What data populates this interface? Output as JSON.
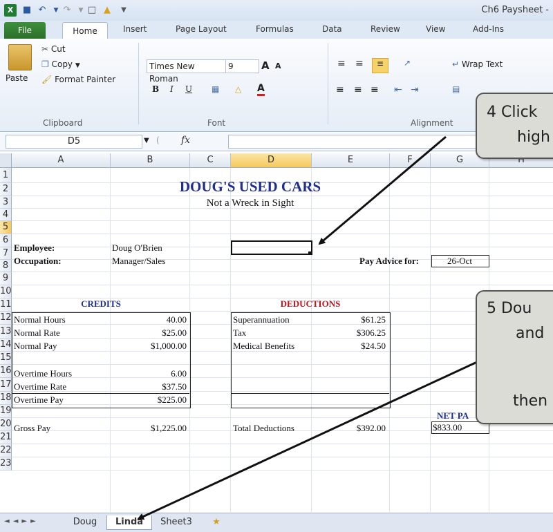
{
  "window": {
    "title": "Ch6 Paysheet -"
  },
  "quick_access": [
    "save-icon",
    "undo-icon",
    "redo-icon",
    "new-icon",
    "open-icon"
  ],
  "ribbon_tabs": [
    "File",
    "Home",
    "Insert",
    "Page Layout",
    "Formulas",
    "Data",
    "Review",
    "View",
    "Add-Ins"
  ],
  "clipboard": {
    "paste": "Paste",
    "cut": "Cut",
    "copy": "Copy",
    "format_painter": "Format Painter",
    "label": "Clipboard"
  },
  "font": {
    "name": "Times New Roman",
    "size": "9",
    "label": "Font",
    "bold": "B",
    "italic": "I",
    "underline": "U",
    "grow": "A",
    "shrink": "A"
  },
  "alignment": {
    "wrap_text": "Wrap Text",
    "label": "Alignment"
  },
  "formula_bar": {
    "name_box": "D5",
    "fx": "fx",
    "content": ""
  },
  "columns": [
    "A",
    "B",
    "C",
    "D",
    "E",
    "F",
    "G",
    "H"
  ],
  "rows": [
    "1",
    "2",
    "3",
    "4",
    "5",
    "6",
    "7",
    "8",
    "9",
    "10",
    "11",
    "12",
    "13",
    "14",
    "15",
    "16",
    "17",
    "18",
    "19",
    "20",
    "21",
    "22",
    "23"
  ],
  "sheet": {
    "title": "DOUG'S USED CARS",
    "subtitle": "Not a Wreck in Sight",
    "employee_label": "Employee:",
    "employee": "Doug O'Brien",
    "occupation_label": "Occupation:",
    "occupation": "Manager/Sales",
    "pay_advice_label": "Pay Advice for:",
    "pay_advice_date": "26-Oct",
    "credits_header": "CREDITS",
    "deductions_header": "DEDUCTIONS",
    "credits": [
      {
        "label": "Normal Hours",
        "value": "40.00"
      },
      {
        "label": "Normal Rate",
        "value": "$25.00"
      },
      {
        "label": "Normal Pay",
        "value": "$1,000.00"
      },
      {
        "label": "Overtime Hours",
        "value": "6.00"
      },
      {
        "label": "Overtime Rate",
        "value": "$37.50"
      },
      {
        "label": "Overtime Pay",
        "value": "$225.00"
      },
      {
        "label": "Gross Pay",
        "value": "$1,225.00"
      }
    ],
    "deductions": [
      {
        "label": "Superannuation",
        "value": "$61.25"
      },
      {
        "label": "Tax",
        "value": "$306.25"
      },
      {
        "label": "Medical Benefits",
        "value": "$24.50"
      },
      {
        "label": "Total Deductions",
        "value": "$392.00"
      }
    ],
    "net_pay_label": "NET PA",
    "net_pay_value": "$833.00"
  },
  "sheet_tabs": [
    "Doug",
    "Linda",
    "Sheet3"
  ],
  "active_sheet": "Linda",
  "callouts": {
    "c4_line1": "4  Click",
    "c4_line2": "high",
    "c5_line1": "5  Dou",
    "c5_line2": "and",
    "c5_line3": "then"
  },
  "colors": {
    "title_blue": "#1f2f8f",
    "credits_blue": "#1f2f8f",
    "deductions_red": "#c0141c",
    "net_pay_blue": "#1f2f8f",
    "file_tab_green": "#2c6f2b"
  }
}
